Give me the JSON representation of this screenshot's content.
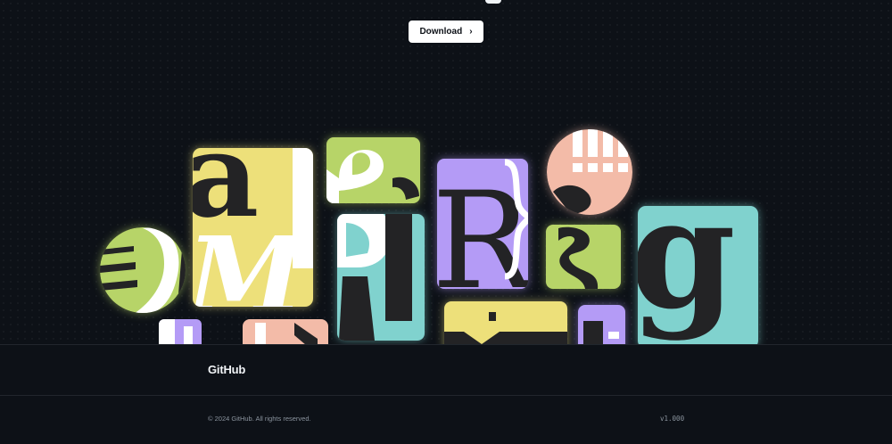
{
  "hero": {
    "download_label": "Download",
    "download_icon": "chevron-right-icon",
    "chevron_glyph": "›"
  },
  "artwork": {
    "tile_colors": {
      "yellow": "#ede07a",
      "green": "#b7d468",
      "purple": "#b49bf6",
      "teal": "#80d2ce",
      "peach": "#f3bba8",
      "white": "#ffffff",
      "ink": "#232325"
    },
    "glyphs": [
      "a",
      "M",
      "R",
      "R",
      "q",
      "g",
      "3",
      "L"
    ]
  },
  "footer": {
    "logo": "GitHub",
    "copyright": "© 2024 GitHub. All rights reserved.",
    "version": "v1.000"
  },
  "colors": {
    "background": "#0d1117",
    "border": "#21262d",
    "muted_text": "#8b949e"
  }
}
